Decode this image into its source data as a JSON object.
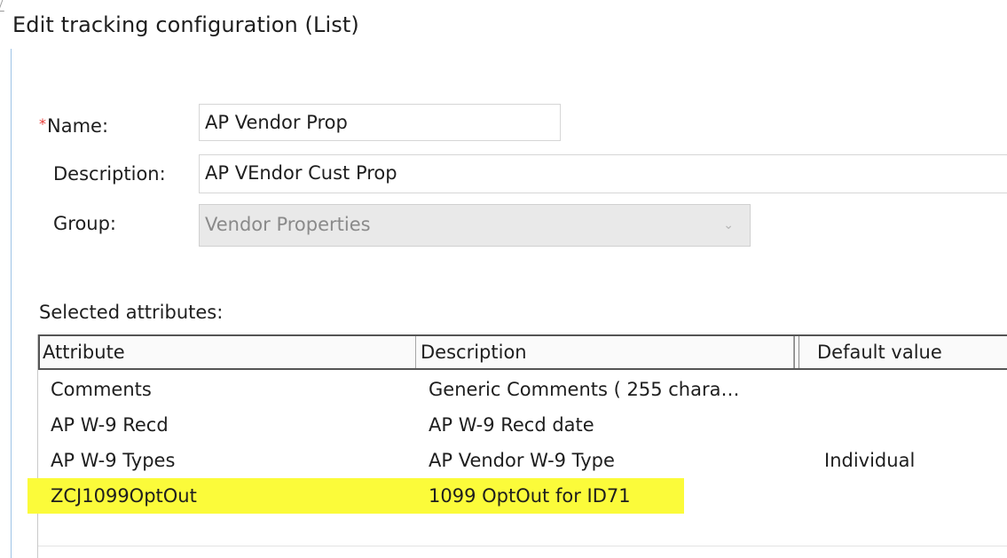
{
  "dialog": {
    "title": "Edit tracking configuration (List)"
  },
  "form": {
    "name_label": "Name:",
    "name_required_marker": "*",
    "name_value": "AP Vendor Prop",
    "description_label": "Description:",
    "description_value": "AP VEndor Cust  Prop",
    "group_label": "Group:",
    "group_value": "Vendor Properties"
  },
  "attributes": {
    "section_label": "Selected attributes:",
    "columns": {
      "attribute": "Attribute",
      "description": "Description",
      "default_value": "Default value"
    },
    "rows": [
      {
        "attribute": "Comments",
        "description": "Generic Comments ( 255 chara…",
        "default_value": ""
      },
      {
        "attribute": "AP W-9 Recd",
        "description": "AP W-9 Recd date",
        "default_value": ""
      },
      {
        "attribute": "AP W-9 Types",
        "description": "AP Vendor W-9 Type",
        "default_value": "Individual"
      },
      {
        "attribute": "ZCJ1099OptOut",
        "description": "1099 OptOut for ID71",
        "default_value": "",
        "highlighted": true
      }
    ]
  },
  "colors": {
    "highlight": "#fbfb3a",
    "required": "#e53935",
    "disabled_bg": "#e9e9e9"
  },
  "icons": {
    "group_dropdown": "chevron-down-icon"
  }
}
